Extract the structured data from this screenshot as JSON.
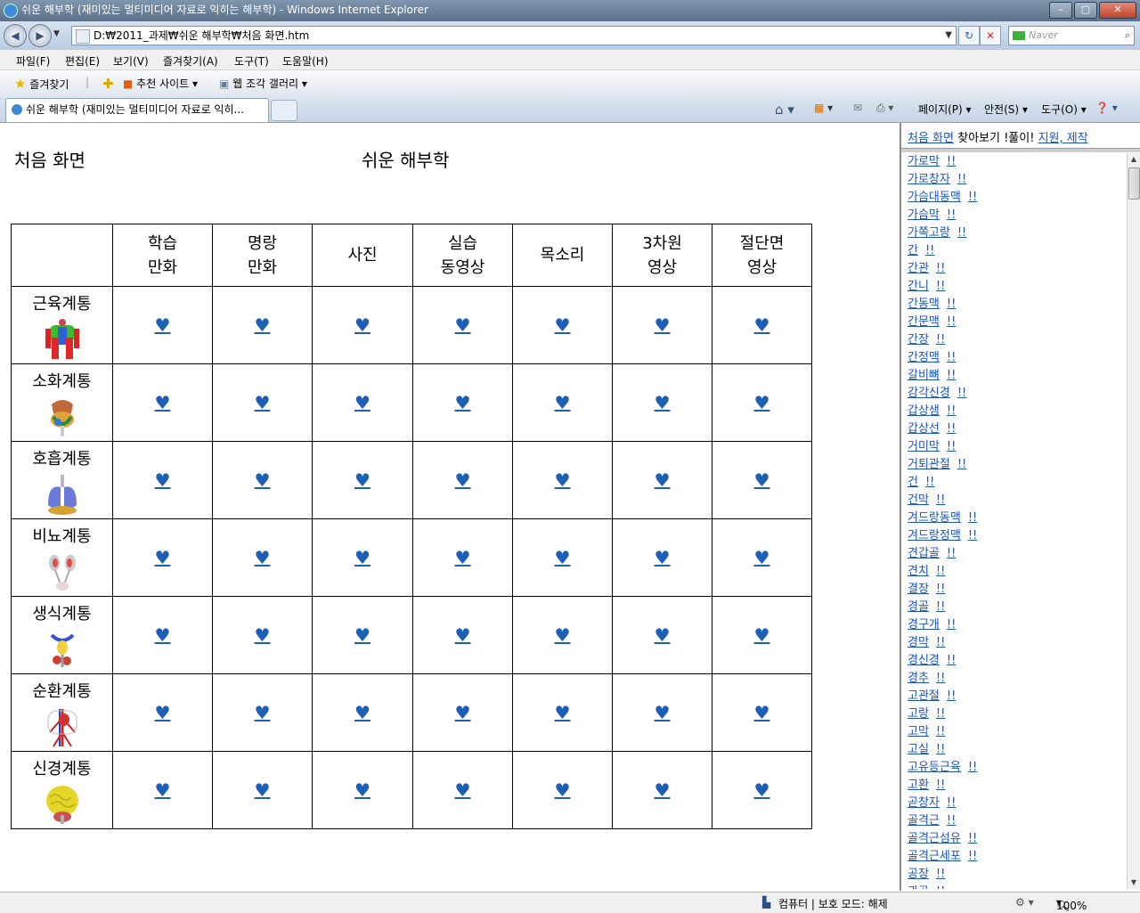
{
  "window": {
    "title": "쉬운 해부학 (재미있는 멀티미디어 자료로 익히는 해부학) - Windows Internet Explorer",
    "address": "D:₩2011_과제₩쉬운 해부학₩처음 화면.htm",
    "search_placeholder": "Naver"
  },
  "menu": [
    "파일(F)",
    "편집(E)",
    "보기(V)",
    "즐겨찾기(A)",
    "도구(T)",
    "도움말(H)"
  ],
  "favorites": {
    "favorites_label": "즐겨찾기",
    "suggested_sites": "추천 사이트",
    "web_slice_gallery": "웹 조각 갤러리"
  },
  "tab": {
    "label": "쉬운 해부학 (재미있는 멀티미디어 자료로 익히..."
  },
  "commands": {
    "page": "페이지(P)",
    "safety": "안전(S)",
    "tools": "도구(O)"
  },
  "page": {
    "left_title": "처음 화면",
    "center_title": "쉬운 해부학",
    "columns": [
      [
        "학습",
        "만화"
      ],
      [
        "명랑",
        "만화"
      ],
      [
        "사진",
        ""
      ],
      [
        "실습",
        "동영상"
      ],
      [
        "목소리",
        ""
      ],
      [
        "3차원",
        "영상"
      ],
      [
        "절단면",
        "영상"
      ]
    ],
    "rows": [
      "근육계통",
      "소화계통",
      "호흡계통",
      "비뇨계통",
      "생식계통",
      "순환계통",
      "신경계통"
    ],
    "heart": "♥"
  },
  "rframe": {
    "home_link": "처음 화면",
    "search_text": " 찾아보기 !풀이! ",
    "credits_link": "지원, 제작",
    "mark": "!!",
    "terms": [
      "가로막",
      "가로창자",
      "가슴대동맥",
      "가슴막",
      "가쪽고랑",
      "간",
      "간관",
      "간니",
      "간동맥",
      "간문맥",
      "간장",
      "간정맥",
      "갈비뼈",
      "감각신경",
      "갑상샘",
      "갑상선",
      "거미막",
      "거퇴관절",
      "건",
      "건막",
      "겨드랑동맥",
      "겨드랑정맥",
      "견갑골",
      "견치",
      "결장",
      "경골",
      "경구개",
      "경막",
      "경신경",
      "경추",
      "고관절",
      "고랑",
      "고막",
      "고실",
      "고유등근육",
      "고환",
      "곧창자",
      "골격근",
      "골격근섬유",
      "골격근세포",
      "공장",
      "관골"
    ]
  },
  "status": {
    "zone": "컴퓨터 | 보호 모드: 해제",
    "zoom": "100%"
  },
  "colors": {
    "link": "#1d55b5",
    "heart": "#1d5fb4",
    "titlebar": "#6d839c"
  }
}
